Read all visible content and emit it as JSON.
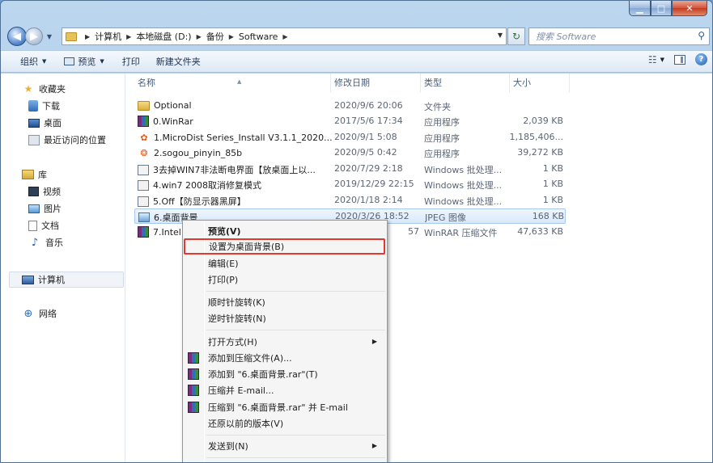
{
  "window": {
    "minimize_glyph": "▁",
    "maximize_glyph": "□",
    "close_glyph": "✕"
  },
  "navigation": {
    "back_glyph": "◀",
    "forward_glyph": "▶",
    "recent_glyph": "▼"
  },
  "address_bar": {
    "crumbs": [
      "计算机",
      "本地磁盘 (D:)",
      "备份",
      "Software"
    ],
    "separator": "▶",
    "dropdown_glyph": "▼"
  },
  "search": {
    "placeholder": "搜索 Software",
    "icon": "magnifier-icon",
    "icon_glyph": "⚲"
  },
  "refresh": {
    "icon": "refresh-icon",
    "glyph": "↻"
  },
  "toolbar": {
    "organize": "组织",
    "preview": "预览",
    "print": "打印",
    "new_folder": "新建文件夹",
    "caret": "▼",
    "view_glyph": "☷",
    "help_glyph": "?"
  },
  "nav_pane": {
    "favorites": "收藏夹",
    "downloads": "下载",
    "desktop": "桌面",
    "recent": "最近访问的位置",
    "libraries": "库",
    "videos": "视频",
    "pictures": "图片",
    "documents": "文档",
    "music": "音乐",
    "computer": "计算机",
    "network": "网络",
    "star_glyph": "★",
    "music_glyph": "♪",
    "network_glyph": "⊕"
  },
  "columns": {
    "name": "名称",
    "date": "修改日期",
    "type": "类型",
    "size": "大小",
    "sort_glyph": "▲"
  },
  "files": [
    {
      "name": "Optional",
      "date": "2020/9/6 20:06",
      "type": "文件夹",
      "size": "",
      "icon": "folder-icon"
    },
    {
      "name": "0.WinRar",
      "date": "2017/5/6 17:34",
      "type": "应用程序",
      "size": "2,039 KB",
      "icon": "winrar-icon"
    },
    {
      "name": "1.MicroDist Series_Install V3.1.1_2020...",
      "date": "2020/9/1 5:08",
      "type": "应用程序",
      "size": "1,185,406...",
      "icon": "installer-icon"
    },
    {
      "name": "2.sogou_pinyin_85b",
      "date": "2020/9/5 0:42",
      "type": "应用程序",
      "size": "39,272 KB",
      "icon": "sogou-icon"
    },
    {
      "name": "3去掉WIN7非法断电界面【放桌面上以...",
      "date": "2020/7/29 2:18",
      "type": "Windows 批处理...",
      "size": "1 KB",
      "icon": "batch-icon"
    },
    {
      "name": "4.win7 2008取消修复模式",
      "date": "2019/12/29 22:15",
      "type": "Windows 批处理...",
      "size": "1 KB",
      "icon": "batch-icon"
    },
    {
      "name": "5.Off【防显示器黑屏】",
      "date": "2020/1/18 2:14",
      "type": "Windows 批处理...",
      "size": "1 KB",
      "icon": "batch-icon"
    },
    {
      "name": "6.桌面背景",
      "date": "2020/3/26 18:52",
      "type": "JPEG 图像",
      "size": "168 KB",
      "icon": "jpeg-icon"
    },
    {
      "name": "7.Intel",
      "date": "57",
      "type": "WinRAR 压缩文件",
      "size": "47,633 KB",
      "icon": "rar-archive-icon"
    }
  ],
  "context_menu": {
    "preview": "预览(V)",
    "set_wallpaper": "设置为桌面背景(B)",
    "edit": "编辑(E)",
    "print": "打印(P)",
    "rotate_cw": "顺时针旋转(K)",
    "rotate_ccw": "逆时针旋转(N)",
    "open_with": "打开方式(H)",
    "add_archive": "添加到压缩文件(A)...",
    "add_to_rar": "添加到 \"6.桌面背景.rar\"(T)",
    "compress_email": "压缩并 E-mail...",
    "compress_rar_email": "压缩到 \"6.桌面背景.rar\" 并 E-mail",
    "restore_previous": "还原以前的版本(V)",
    "send_to": "发送到(N)",
    "submenu_glyph": "▶",
    "highlight_color": "#e2382d"
  }
}
